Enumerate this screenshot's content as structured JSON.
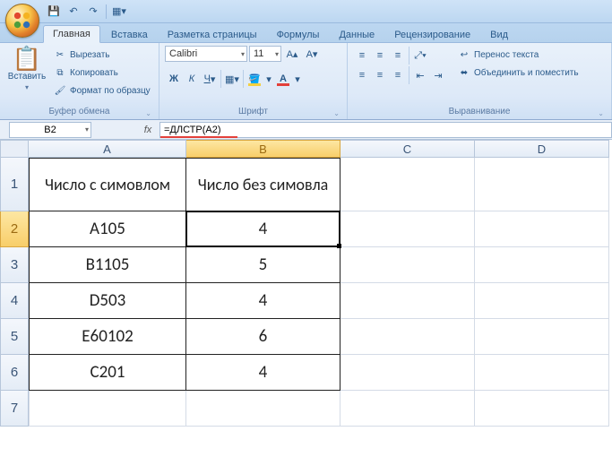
{
  "tabs": {
    "home": "Главная",
    "insert": "Вставка",
    "layout": "Разметка страницы",
    "formulas": "Формулы",
    "data": "Данные",
    "review": "Рецензирование",
    "view": "Вид"
  },
  "clipboard": {
    "paste": "Вставить",
    "cut": "Вырезать",
    "copy": "Копировать",
    "painter": "Формат по образцу",
    "group": "Буфер обмена"
  },
  "font": {
    "name": "Calibri",
    "size": "11",
    "group": "Шрифт"
  },
  "align": {
    "wrap": "Перенос текста",
    "merge": "Объединить и поместить",
    "group": "Выравнивание"
  },
  "formula_bar": {
    "name": "B2",
    "formula": "=ДЛСТР(A2)"
  },
  "columns": {
    "A": "A",
    "B": "B",
    "C": "C",
    "D": "D"
  },
  "header": {
    "A": "Число с симовлом",
    "B": "Число без симовла"
  },
  "cells": {
    "r2": {
      "A": "A105",
      "B": "4"
    },
    "r3": {
      "A": "B1105",
      "B": "5"
    },
    "r4": {
      "A": "D503",
      "B": "4"
    },
    "r5": {
      "A": "E60102",
      "B": "6"
    },
    "r6": {
      "A": "C201",
      "B": "4"
    }
  },
  "row_labels": {
    "1": "1",
    "2": "2",
    "3": "3",
    "4": "4",
    "5": "5",
    "6": "6",
    "7": "7"
  }
}
